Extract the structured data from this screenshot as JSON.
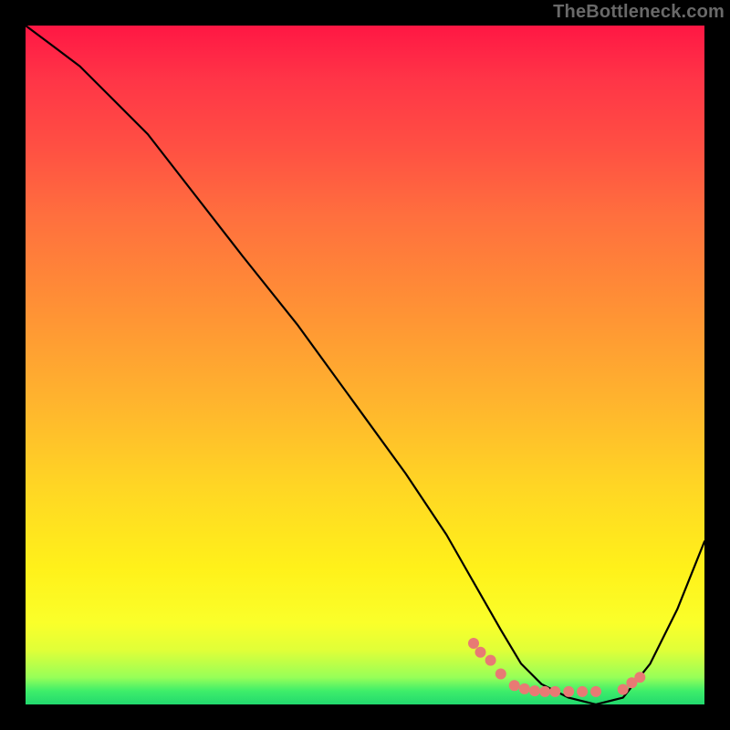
{
  "watermark": "TheBottleneck.com",
  "chart_data": {
    "type": "line",
    "title": "",
    "xlabel": "",
    "ylabel": "",
    "xlim": [
      0,
      1
    ],
    "ylim": [
      0,
      1
    ],
    "grid": false,
    "series": [
      {
        "name": "curve",
        "x": [
          0.0,
          0.04,
          0.08,
          0.12,
          0.18,
          0.25,
          0.32,
          0.4,
          0.48,
          0.56,
          0.62,
          0.66,
          0.7,
          0.73,
          0.76,
          0.8,
          0.84,
          0.88,
          0.92,
          0.96,
          1.0
        ],
        "values": [
          1.0,
          0.97,
          0.94,
          0.9,
          0.84,
          0.75,
          0.66,
          0.56,
          0.45,
          0.34,
          0.25,
          0.18,
          0.11,
          0.06,
          0.03,
          0.01,
          0.0,
          0.01,
          0.06,
          0.14,
          0.24
        ]
      }
    ],
    "highlight_dots": {
      "name": "valley-dots",
      "x": [
        0.66,
        0.67,
        0.685,
        0.7,
        0.72,
        0.735,
        0.75,
        0.765,
        0.78,
        0.8,
        0.82,
        0.84,
        0.88,
        0.893,
        0.905
      ],
      "values": [
        0.09,
        0.077,
        0.065,
        0.045,
        0.028,
        0.023,
        0.02,
        0.019,
        0.019,
        0.019,
        0.019,
        0.019,
        0.022,
        0.032,
        0.04
      ]
    }
  }
}
